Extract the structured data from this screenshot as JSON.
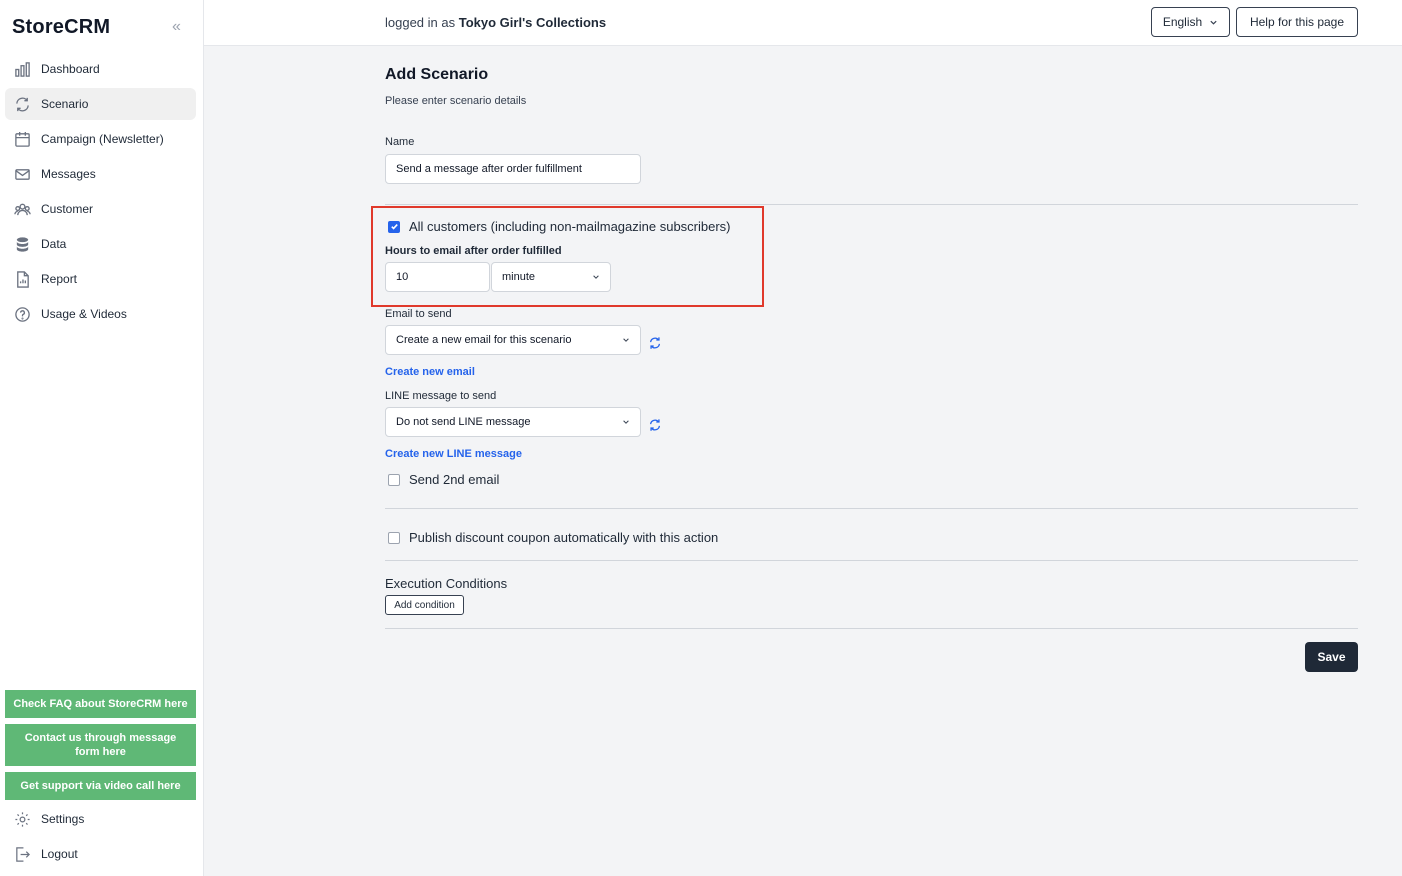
{
  "sidebar": {
    "logo": "StoreCRM",
    "items": [
      {
        "label": "Dashboard",
        "icon": "bar-chart-icon"
      },
      {
        "label": "Scenario",
        "icon": "refresh-icon",
        "active": true
      },
      {
        "label": "Campaign (Newsletter)",
        "icon": "calendar-icon"
      },
      {
        "label": "Messages",
        "icon": "mail-icon"
      },
      {
        "label": "Customer",
        "icon": "users-icon"
      },
      {
        "label": "Data",
        "icon": "database-icon"
      },
      {
        "label": "Report",
        "icon": "document-icon"
      },
      {
        "label": "Usage & Videos",
        "icon": "help-icon"
      }
    ],
    "support_buttons": [
      "Check FAQ about StoreCRM here",
      "Contact us through message form here",
      "Get support via video call here"
    ],
    "settings": "Settings",
    "logout": "Logout"
  },
  "header": {
    "logged_prefix": "logged in as",
    "store_name": "Tokyo Girl's Collections",
    "language": "English",
    "help": "Help for this page"
  },
  "form": {
    "title": "Add Scenario",
    "subtitle": "Please enter scenario details",
    "name_label": "Name",
    "name_value": "Send a message after order fulfillment",
    "all_customers_label": "All customers (including non-mailmagazine subscribers)",
    "all_customers_checked": true,
    "hours_label": "Hours to email after order fulfilled",
    "hours_value": "10",
    "unit_value": "minute",
    "email_label": "Email to send",
    "email_value": "Create a new email for this scenario",
    "create_email": "Create new email",
    "line_label": "LINE message to send",
    "line_value": "Do not send LINE message",
    "create_line": "Create new LINE message",
    "second_email": "Send 2nd email",
    "coupon": "Publish discount coupon automatically with this action",
    "exec_title": "Execution Conditions",
    "add_condition": "Add condition",
    "save": "Save"
  },
  "colors": {
    "accent": "#2563eb",
    "highlight": "#e0392b",
    "support_green": "#5fb876",
    "save_bg": "#1f2937"
  }
}
